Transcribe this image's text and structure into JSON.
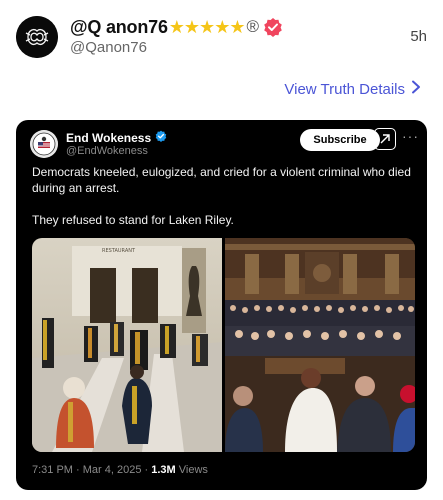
{
  "post": {
    "display_name": "@Q anon76",
    "stars": "★★★★★",
    "registered": "®",
    "handle": "@Qanon76",
    "time": "5h",
    "details_link": "View Truth Details"
  },
  "embed": {
    "author_name": "End Wokeness",
    "author_handle": "@EndWokeness",
    "subscribe_label": "Subscribe",
    "more_label": "···",
    "text_1": "Democrats kneeled, eulogized, and cried for a violent criminal who died during an arrest.",
    "text_2": "They refused to stand for Laken Riley.",
    "media_left_sign": "RESTAURANT",
    "meta_prefix": "7:31 PM · Mar 4, 2025 · ",
    "views_count": "1.3M",
    "views_label": " Views"
  },
  "colors": {
    "link": "#4b55d6",
    "verified_badge": "#f0455e",
    "star": "#f5c518",
    "embed_verified": "#1d9bf0"
  },
  "icons": {
    "avatar": "ornate-knot-avatar",
    "verified": "verified-badge-icon",
    "chevron": "chevron-right-icon",
    "grok": "grok-icon",
    "more": "more-icon"
  }
}
